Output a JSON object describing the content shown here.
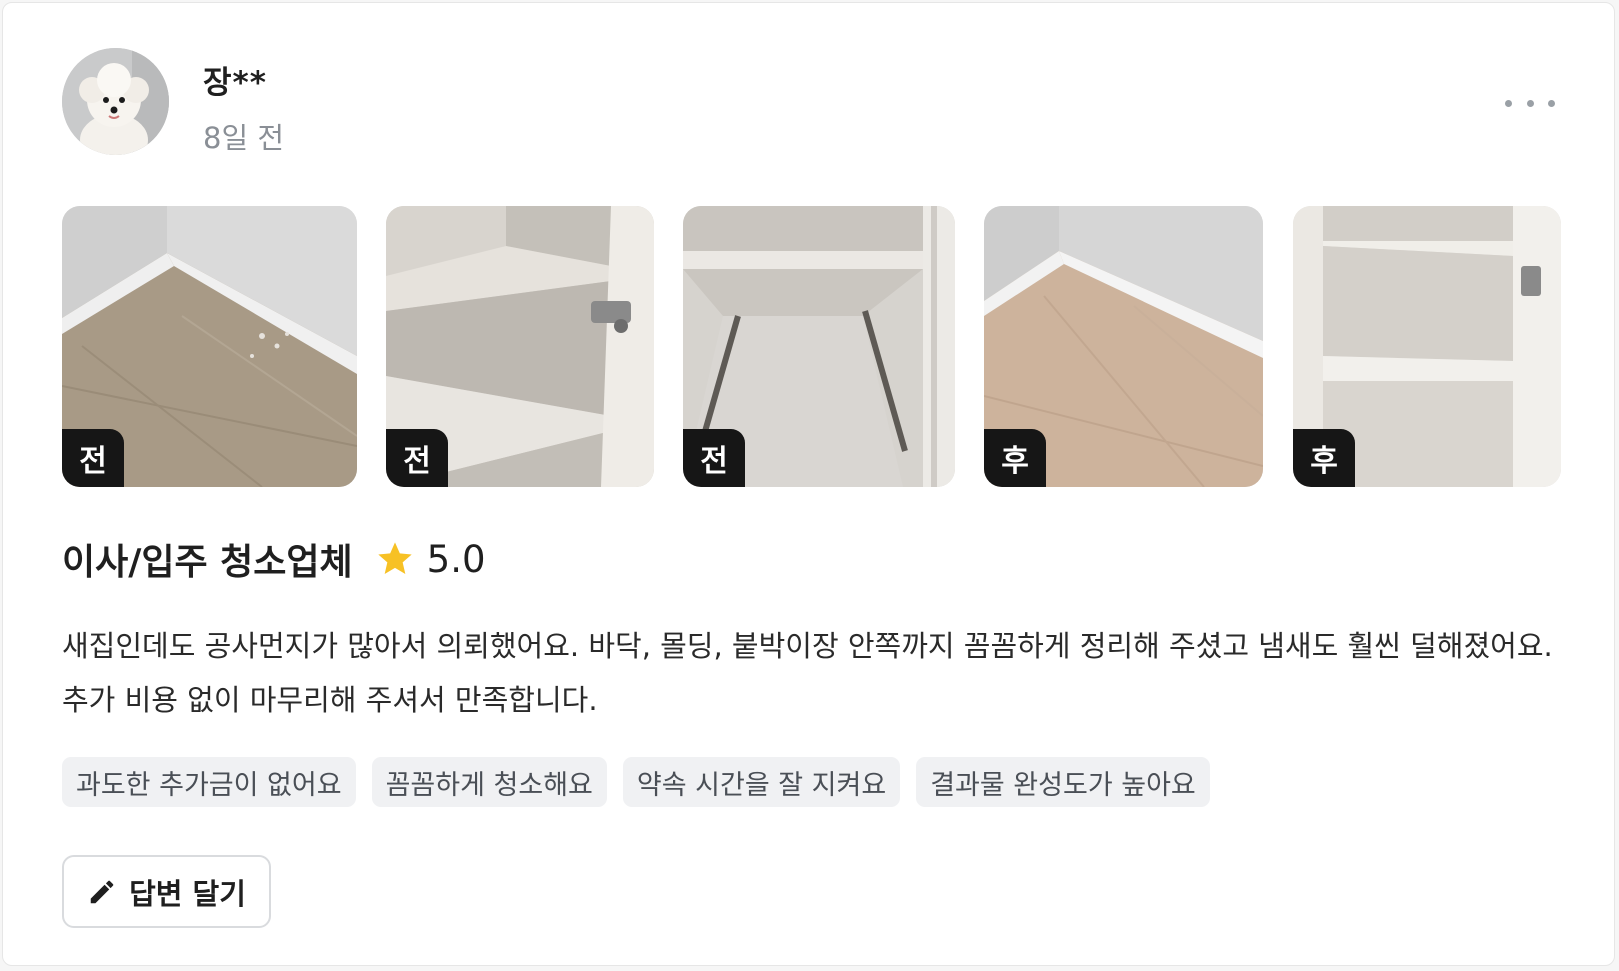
{
  "review": {
    "author": "장**",
    "time_ago": "8일 전",
    "more_icon": "more-horizontal-icon",
    "photos": [
      {
        "badge": "전",
        "scene": "floor-corner-dusty"
      },
      {
        "badge": "전",
        "scene": "cabinet-shelves"
      },
      {
        "badge": "전",
        "scene": "cabinet-drawer-rails"
      },
      {
        "badge": "후",
        "scene": "floor-corner-clean"
      },
      {
        "badge": "후",
        "scene": "cabinet-shelves-clean"
      }
    ],
    "service_title": "이사/입주 청소업체",
    "rating": "5.0",
    "rating_value": 5.0,
    "star_color": "#F7C125",
    "body_line1": "새집인데도 공사먼지가 많아서 의뢰했어요. 바닥, 몰딩, 붙박이장 안쪽까지 꼼꼼하게 정리해 주셨고 냄새도 훨씬 덜해졌어요.",
    "body_line2": "추가 비용 없이 마무리해 주셔서 만족합니다.",
    "tags": [
      "과도한 추가금이 없어요",
      "꼼꼼하게 청소해요",
      "약속 시간을 잘 지켜요",
      "결과물 완성도가 높아요"
    ],
    "reply_button_label": "답변 달기",
    "reply_icon": "pencil-icon"
  }
}
